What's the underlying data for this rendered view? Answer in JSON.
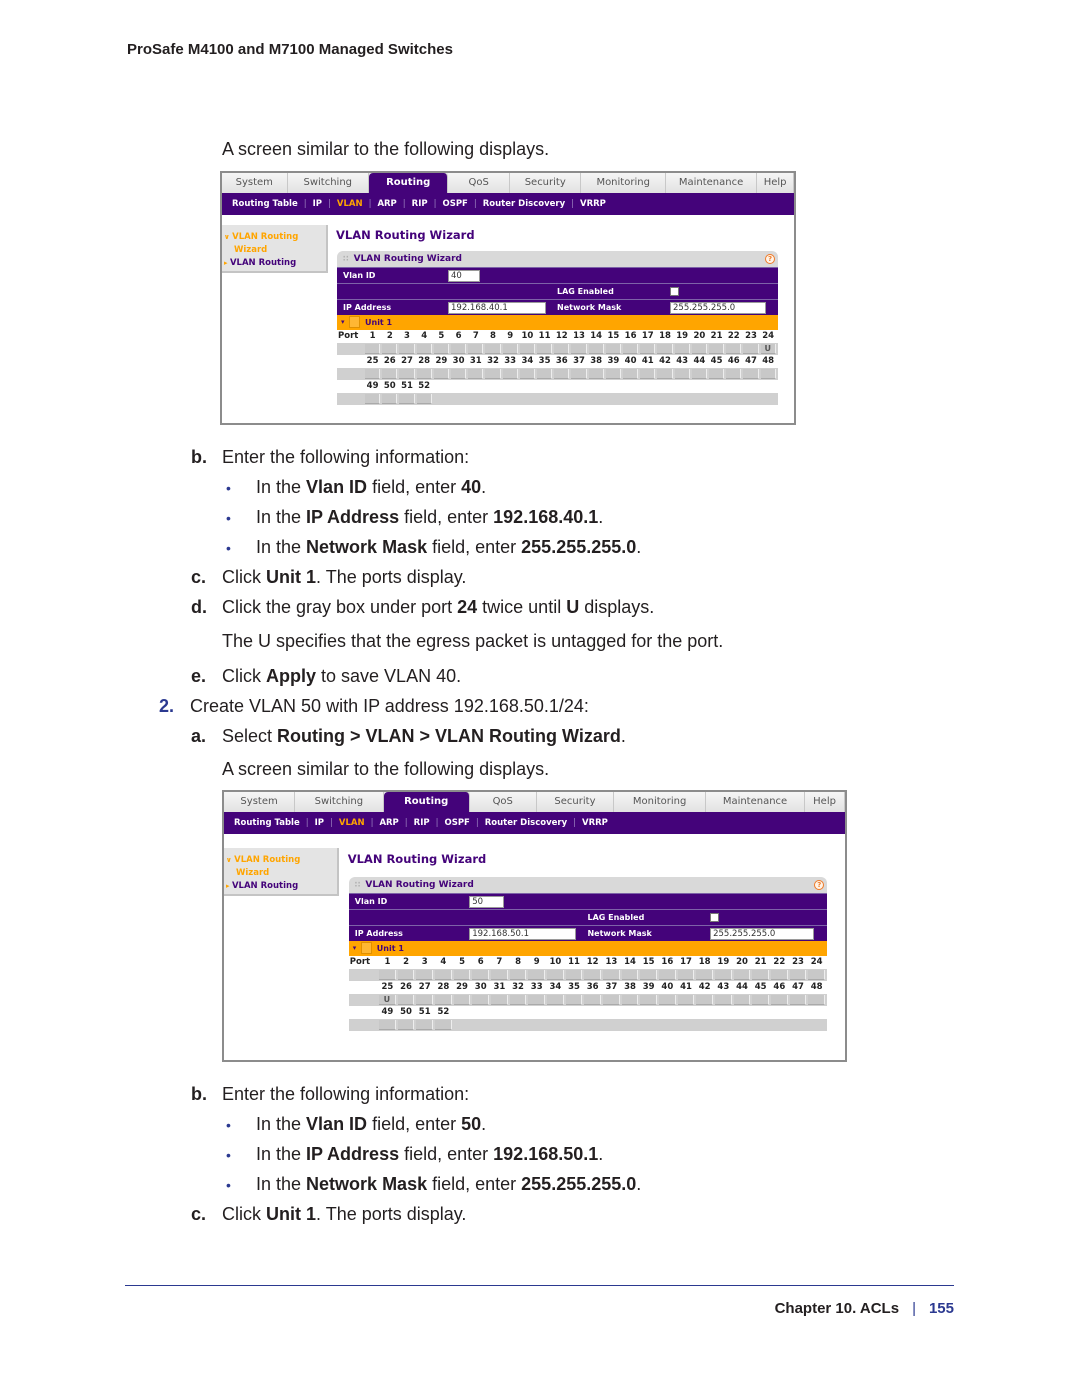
{
  "header": {
    "title": "ProSafe M4100 and M7100 Managed Switches"
  },
  "text": {
    "screen_similar_1": "A screen similar to the following displays.",
    "step_b1": {
      "marker": "b.",
      "text": "Enter the following information:"
    },
    "bullets1": [
      {
        "pre": "In the ",
        "field": "Vlan ID",
        "mid": " field, enter ",
        "value": "40",
        "post": "."
      },
      {
        "pre": "In the ",
        "field": "IP Address",
        "mid": " field, enter ",
        "value": "192.168.40.1",
        "post": "."
      },
      {
        "pre": "In the ",
        "field": "Network Mask",
        "mid": " field, enter ",
        "value": "255.255.255.0",
        "post": "."
      }
    ],
    "step_c1": {
      "marker": "c.",
      "pre": "Click ",
      "bold": "Unit 1",
      "post": ". The ports display."
    },
    "step_d1": {
      "marker": "d.",
      "pre": "Click the gray box under port ",
      "bold": "24",
      "mid": " twice until ",
      "bold2": "U",
      "post": " displays."
    },
    "step_d1_note": "The U specifies that the egress packet is untagged for the port.",
    "step_e1": {
      "marker": "e.",
      "pre": "Click ",
      "bold": "Apply",
      "post": " to save VLAN 40."
    },
    "step_2": {
      "marker": "2.",
      "text": "Create VLAN 50 with IP address 192.168.50.1/24:"
    },
    "step_a2": {
      "marker": "a.",
      "pre": "Select ",
      "bold": "Routing > VLAN > VLAN Routing Wizard",
      "post": "."
    },
    "screen_similar_2": "A screen similar to the following displays.",
    "step_b2": {
      "marker": "b.",
      "text": "Enter the following information:"
    },
    "bullets2": [
      {
        "pre": "In the ",
        "field": "Vlan ID",
        "mid": " field, enter ",
        "value": "50",
        "post": "."
      },
      {
        "pre": "In the ",
        "field": "IP Address",
        "mid": " field, enter ",
        "value": "192.168.50.1",
        "post": "."
      },
      {
        "pre": "In the ",
        "field": "Network Mask",
        "mid": " field, enter ",
        "value": "255.255.255.0",
        "post": "."
      }
    ],
    "step_c2": {
      "marker": "c.",
      "pre": "Click ",
      "bold": "Unit 1",
      "post": ". The ports display."
    }
  },
  "ui": {
    "tabs": [
      "System",
      "Switching",
      "Routing",
      "QoS",
      "Security",
      "Monitoring",
      "Maintenance",
      "Help"
    ],
    "active_tab": "Routing",
    "subnav": [
      "Routing Table",
      "IP",
      "VLAN",
      "ARP",
      "RIP",
      "OSPF",
      "Router Discovery",
      "VRRP"
    ],
    "active_subnav": "VLAN",
    "leftnav": {
      "item1_line1": "VLAN Routing",
      "item1_line2": "Wizard",
      "item2": "VLAN Routing"
    },
    "page_heading": "VLAN Routing Wizard",
    "panel_title": "VLAN Routing Wizard",
    "labels": {
      "vlan_id": "Vlan ID",
      "lag_enabled": "LAG Enabled",
      "ip_address": "IP Address",
      "network_mask": "Network Mask",
      "unit": "Unit 1",
      "port": "Port",
      "help": "?"
    },
    "ports_row1": [
      "1",
      "2",
      "3",
      "4",
      "5",
      "6",
      "7",
      "8",
      "9",
      "10",
      "11",
      "12",
      "13",
      "14",
      "15",
      "16",
      "17",
      "18",
      "19",
      "20",
      "21",
      "22",
      "23",
      "24"
    ],
    "ports_row2": [
      "25",
      "26",
      "27",
      "28",
      "29",
      "30",
      "31",
      "32",
      "33",
      "34",
      "35",
      "36",
      "37",
      "38",
      "39",
      "40",
      "41",
      "42",
      "43",
      "44",
      "45",
      "46",
      "47",
      "48"
    ],
    "ports_row3": [
      "49",
      "50",
      "51",
      "52"
    ]
  },
  "screens": [
    {
      "vlan_id": "40",
      "ip_address": "192.168.40.1",
      "network_mask": "255.255.255.0",
      "lag_enabled": false,
      "untagged_ports": [
        "24"
      ],
      "marker": "U"
    },
    {
      "vlan_id": "50",
      "ip_address": "192.168.50.1",
      "network_mask": "255.255.255.0",
      "lag_enabled": false,
      "untagged_ports": [
        "25"
      ],
      "marker": "U"
    }
  ],
  "footer": {
    "chapter": "Chapter 10.  ACLs",
    "page": "155"
  },
  "colors": {
    "purple": "#44037a",
    "orange": "#ffa500",
    "doc_blue": "#2b3990"
  }
}
